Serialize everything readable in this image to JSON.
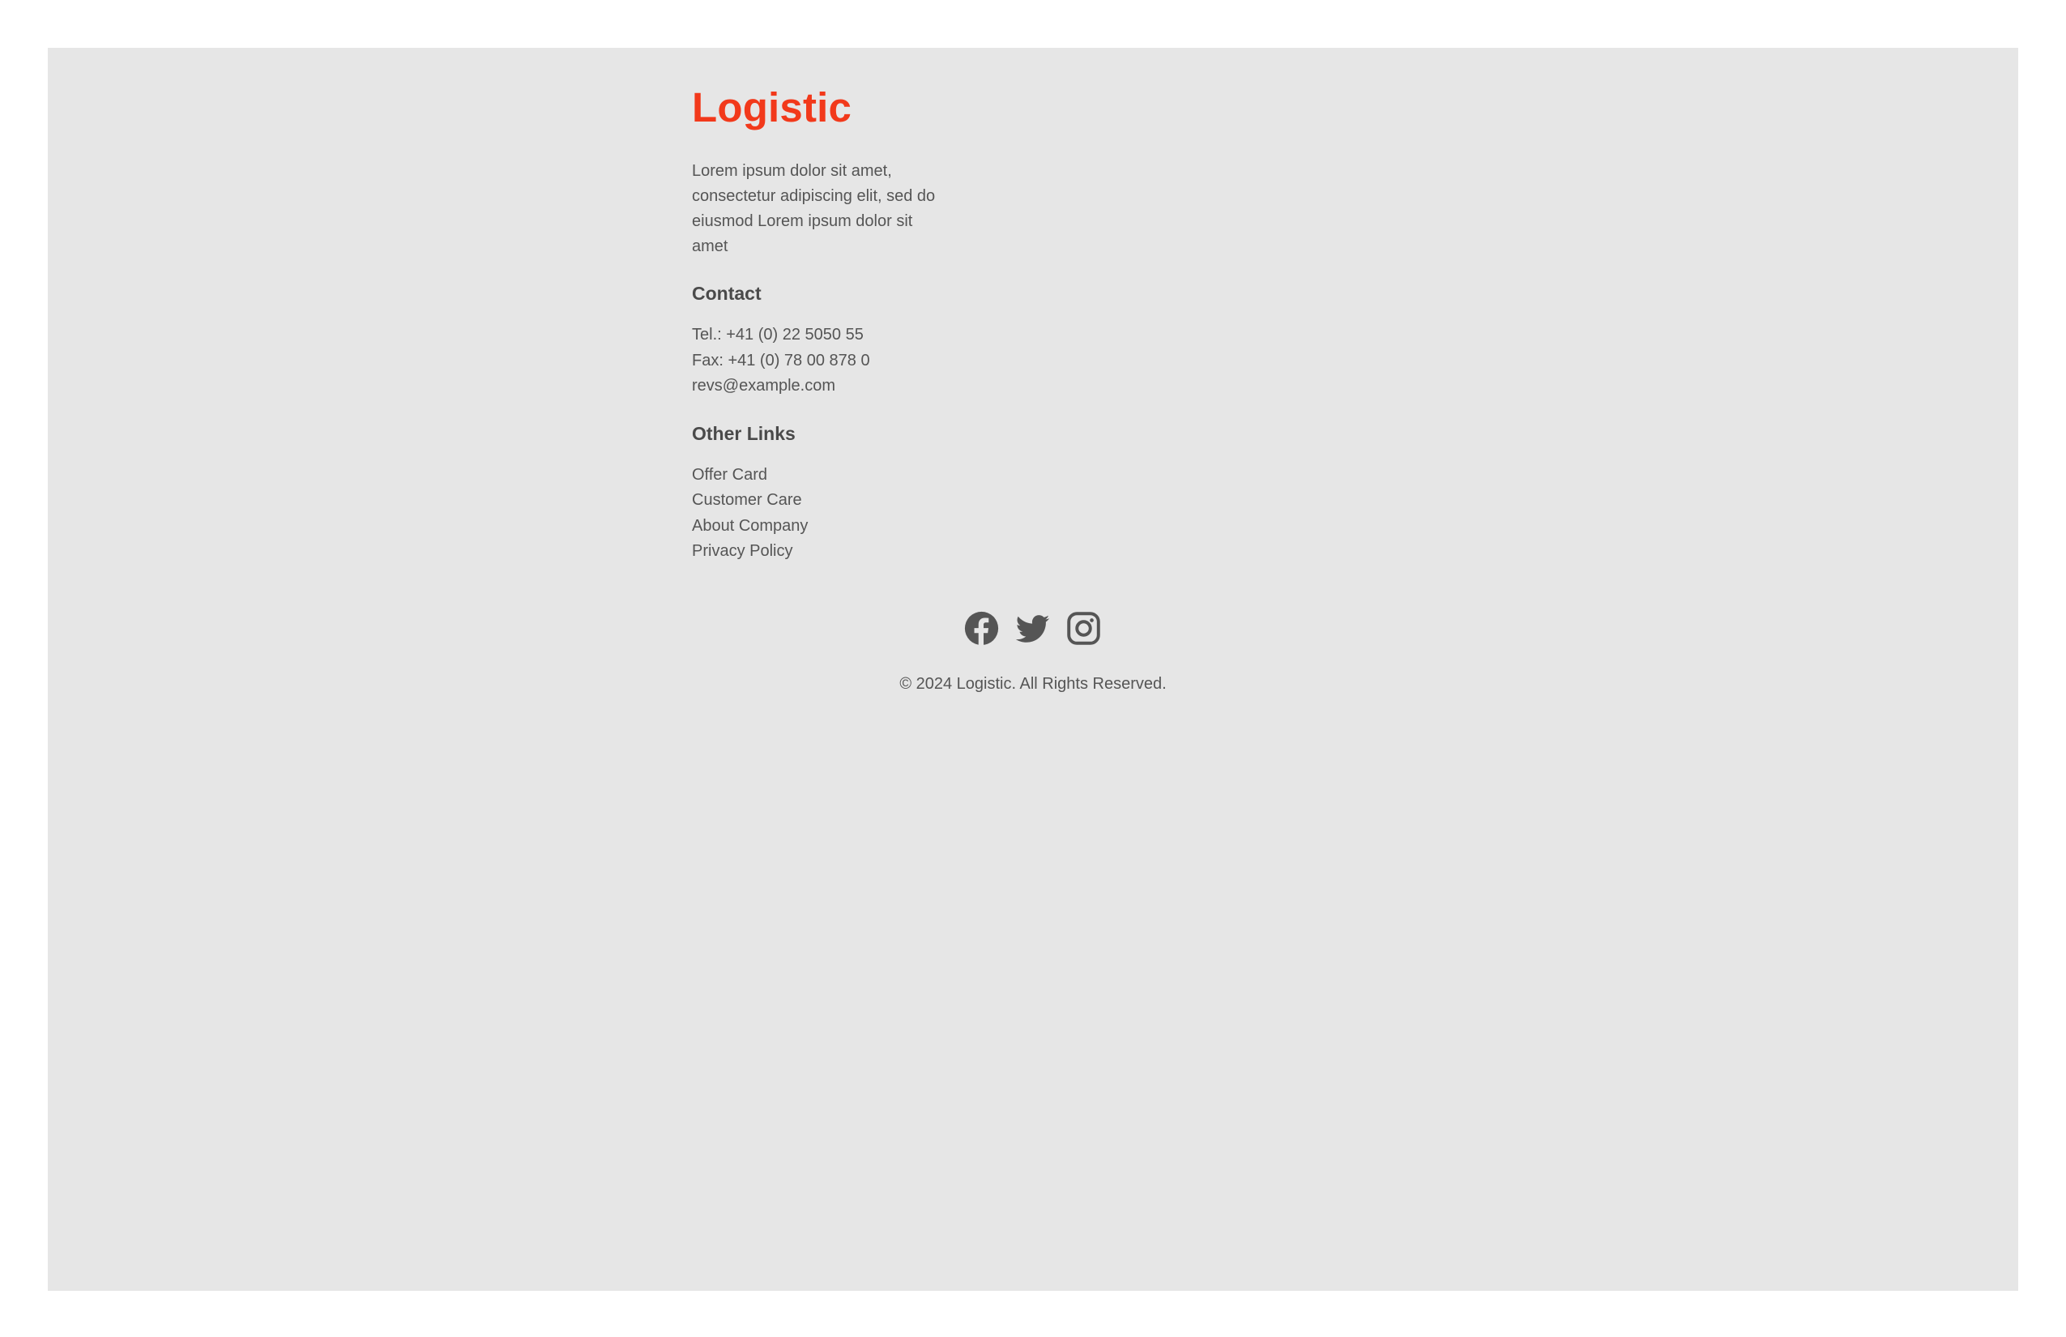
{
  "brand": {
    "title": "Logistic",
    "accent_color": "#f2391b",
    "description": "Lorem ipsum dolor sit amet, consectetur adipiscing elit, sed do eiusmod Lorem ipsum dolor sit amet"
  },
  "contact": {
    "heading": "Contact",
    "items": [
      "Tel.: +41 (0) 22 5050 55",
      "Fax: +41 (0) 78 00 878 0",
      "revs@example.com"
    ]
  },
  "other_links": {
    "heading": "Other Links",
    "items": [
      "Offer Card",
      "Customer Care",
      "About Company",
      "Privacy Policy"
    ]
  },
  "social": {
    "icons": [
      "facebook-icon",
      "twitter-icon",
      "instagram-icon"
    ]
  },
  "footer": {
    "copyright": "© 2024 Logistic. All Rights Reserved."
  }
}
